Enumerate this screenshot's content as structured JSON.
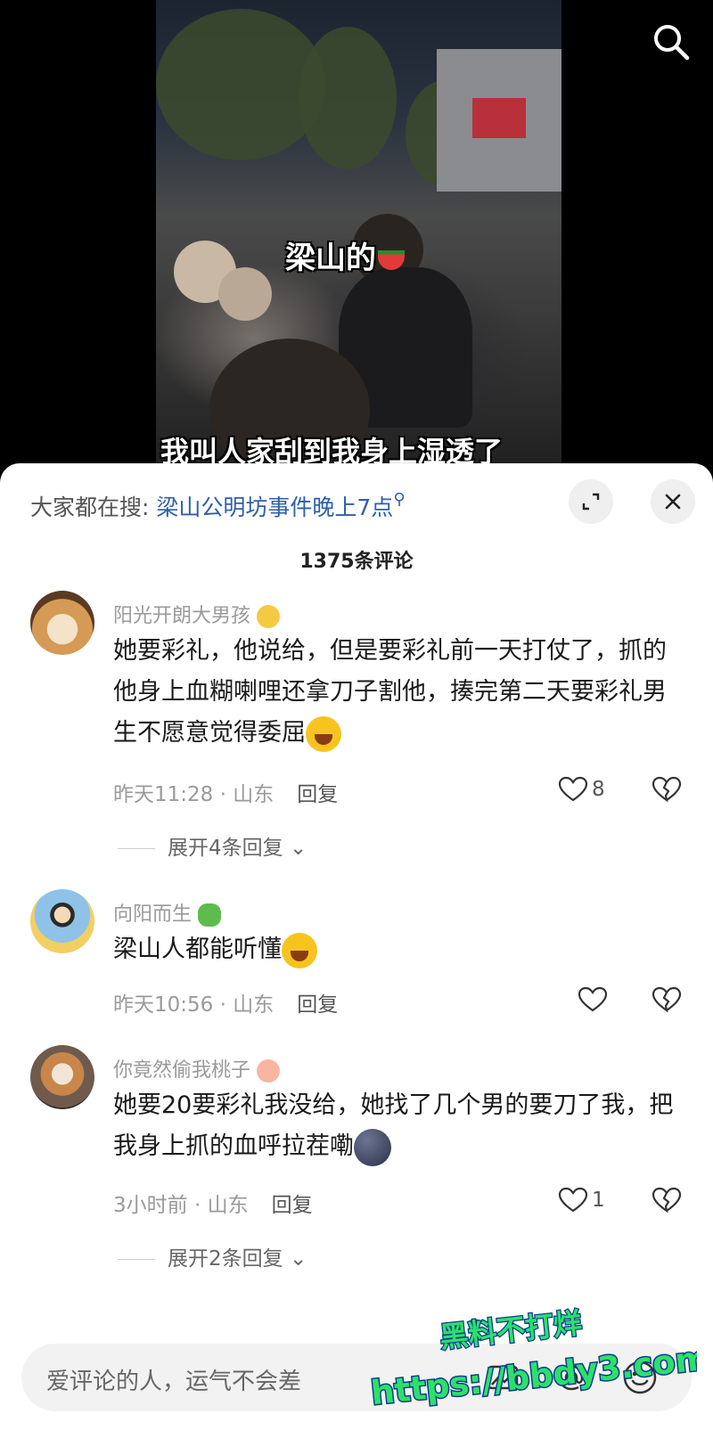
{
  "video": {
    "caption": "梁山的",
    "subtitle": "我叫人家刮到我身上湿透了"
  },
  "hot_search": {
    "prefix": "大家都在搜:",
    "query": "梁山公明坊事件晚上7点",
    "icon": "search-icon"
  },
  "comment_count": "1375条评论",
  "comments": [
    {
      "username": "阳光开朗大男孩",
      "text": "她要彩礼，他说给，但是要彩礼前一天打仗了，抓的他身上血糊喇哩还拿刀子割他，揍完第二天要彩礼男生不愿意觉得委屈",
      "time": "昨天11:28",
      "location": "山东",
      "reply_label": "回复",
      "likes": "8",
      "expand_label": "展开4条回复"
    },
    {
      "username": "向阳而生",
      "text": "梁山人都能听懂",
      "time": "昨天10:56",
      "location": "山东",
      "reply_label": "回复",
      "likes": ""
    },
    {
      "username": "你竟然偷我桃子",
      "text": "她要20要彩礼我没给，她找了几个男的要刀了我，把我身上抓的血呼拉茬嘞",
      "time": "3小时前",
      "location": "山东",
      "reply_label": "回复",
      "likes": "1",
      "expand_label": "展开2条回复"
    }
  ],
  "input": {
    "placeholder": "爱评论的人，运气不会差"
  },
  "watermark": {
    "line1": "黑料不打烊",
    "line2": "https://bbdy3.com"
  },
  "colors": {
    "link": "#2f5fa8",
    "meta": "#9a9a9a",
    "watermark_fill": "#2de06a",
    "watermark_stroke": "#0b3d8f"
  }
}
